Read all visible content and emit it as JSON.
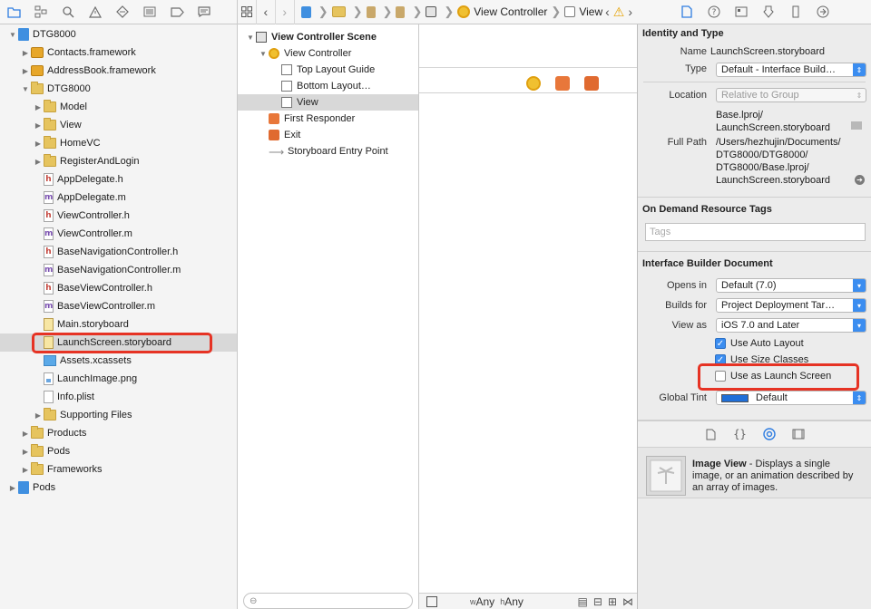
{
  "nav_toolbar": {
    "icons": [
      "folder-icon",
      "hierarchy-icon",
      "search-icon",
      "warning-icon",
      "diamond-icon",
      "list-icon",
      "tag-icon",
      "message-icon"
    ]
  },
  "project_tree": [
    {
      "label": "DTG8000",
      "type": "project",
      "level": 0,
      "open": true
    },
    {
      "label": "Contacts.framework",
      "type": "framework",
      "level": 1,
      "open": false
    },
    {
      "label": "AddressBook.framework",
      "type": "framework",
      "level": 1,
      "open": false
    },
    {
      "label": "DTG8000",
      "type": "folder",
      "level": 1,
      "open": true
    },
    {
      "label": "Model",
      "type": "folder",
      "level": 2,
      "open": false
    },
    {
      "label": "View",
      "type": "folder",
      "level": 2,
      "open": false
    },
    {
      "label": "HomeVC",
      "type": "folder",
      "level": 2,
      "open": false
    },
    {
      "label": "RegisterAndLogin",
      "type": "folder",
      "level": 2,
      "open": false
    },
    {
      "label": "AppDelegate.h",
      "type": "h",
      "level": 2
    },
    {
      "label": "AppDelegate.m",
      "type": "m",
      "level": 2
    },
    {
      "label": "ViewController.h",
      "type": "h",
      "level": 2
    },
    {
      "label": "ViewController.m",
      "type": "m",
      "level": 2
    },
    {
      "label": "BaseNavigationController.h",
      "type": "h",
      "level": 2
    },
    {
      "label": "BaseNavigationController.m",
      "type": "m",
      "level": 2
    },
    {
      "label": "BaseViewController.h",
      "type": "h",
      "level": 2
    },
    {
      "label": "BaseViewController.m",
      "type": "m",
      "level": 2
    },
    {
      "label": "Main.storyboard",
      "type": "storyboard",
      "level": 2
    },
    {
      "label": "LaunchScreen.storyboard",
      "type": "storyboard",
      "level": 2,
      "selected": true
    },
    {
      "label": "Assets.xcassets",
      "type": "assets",
      "level": 2
    },
    {
      "label": "LaunchImage.png",
      "type": "png",
      "level": 2
    },
    {
      "label": "Info.plist",
      "type": "plist",
      "level": 2
    },
    {
      "label": "Supporting Files",
      "type": "folder",
      "level": 2,
      "open": false
    },
    {
      "label": "Products",
      "type": "folder",
      "level": 1,
      "open": false
    },
    {
      "label": "Pods",
      "type": "folder",
      "level": 1,
      "open": false
    },
    {
      "label": "Frameworks",
      "type": "folder",
      "level": 1,
      "open": false
    },
    {
      "label": "Pods",
      "type": "project",
      "level": 0,
      "open": false
    }
  ],
  "jump_bar": {
    "crumbs": [
      {
        "label": "",
        "icon": "doc-icon"
      },
      {
        "label": "",
        "icon": "folder-icon"
      },
      {
        "label": "",
        "icon": "file-icon"
      },
      {
        "label": "",
        "icon": "file-icon"
      },
      {
        "label": "",
        "icon": "scene-icon"
      },
      {
        "label": "View Controller",
        "icon": "view-controller-icon"
      },
      {
        "label": "View",
        "icon": "view-icon"
      }
    ]
  },
  "outline": [
    {
      "label": "View Controller Scene",
      "icon": "scene",
      "level": 0,
      "bold": true,
      "open": true
    },
    {
      "label": "View Controller",
      "icon": "vc",
      "level": 1,
      "open": true
    },
    {
      "label": "Top Layout Guide",
      "icon": "guide",
      "level": 2
    },
    {
      "label": "Bottom Layout…",
      "icon": "guide",
      "level": 2
    },
    {
      "label": "View",
      "icon": "guide",
      "level": 2,
      "selected": true
    },
    {
      "label": "First Responder",
      "icon": "cube",
      "level": 1
    },
    {
      "label": "Exit",
      "icon": "exit",
      "level": 1
    },
    {
      "label": "Storyboard Entry Point",
      "icon": "arrow",
      "level": 1
    }
  ],
  "canvas": {
    "size_class_w": "Any",
    "size_class_h": "Any",
    "w_prefix": "w",
    "h_prefix": "h"
  },
  "inspector": {
    "identity_title": "Identity and Type",
    "name_label": "Name",
    "name_value": "LaunchScreen.storyboard",
    "type_label": "Type",
    "type_value": "Default - Interface Build…",
    "location_label": "Location",
    "location_value": "Relative to Group",
    "location_path_1": "Base.lproj/",
    "location_path_2": "LaunchScreen.storyboard",
    "full_path_label": "Full Path",
    "full_path_1": "/Users/hezhujin/Documents/",
    "full_path_2": "DTG8000/DTG8000/",
    "full_path_3": "DTG8000/Base.lproj/",
    "full_path_4": "LaunchScreen.storyboard",
    "odr_title": "On Demand Resource Tags",
    "tags_placeholder": "Tags",
    "ib_title": "Interface Builder Document",
    "opens_in_label": "Opens in",
    "opens_in_value": "Default (7.0)",
    "builds_for_label": "Builds for",
    "builds_for_value": "Project Deployment Tar…",
    "view_as_label": "View as",
    "view_as_value": "iOS 7.0 and Later",
    "auto_layout_label": "Use Auto Layout",
    "auto_layout_checked": true,
    "size_classes_label": "Use Size Classes",
    "size_classes_checked": true,
    "launch_screen_label": "Use as Launch Screen",
    "launch_screen_checked": false,
    "global_tint_label": "Global Tint",
    "global_tint_value": "Default",
    "global_tint_color": "#1f6fd8"
  },
  "library": {
    "title": "Image View",
    "description": " - Displays a single image, or an animation described by an array of images."
  },
  "colors": {
    "highlight": "#e63324",
    "accent": "#3b8df0"
  }
}
